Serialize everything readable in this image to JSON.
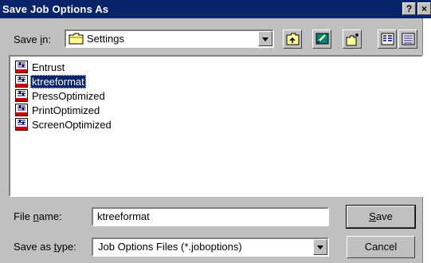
{
  "window": {
    "title": "Save Job Options As",
    "help_glyph": "?",
    "close_glyph": "×"
  },
  "save_in": {
    "label_pre": "Save ",
    "label_hot": "i",
    "label_post": "n:",
    "value": "Settings"
  },
  "toolbar": [
    "up-one-level",
    "desktop",
    "create-new-folder",
    "list-view",
    "details-view"
  ],
  "files": [
    {
      "name": "Entrust",
      "selected": false
    },
    {
      "name": "ktreeformat",
      "selected": true
    },
    {
      "name": "PressOptimized",
      "selected": false
    },
    {
      "name": "PrintOptimized",
      "selected": false
    },
    {
      "name": "ScreenOptimized",
      "selected": false
    }
  ],
  "file_name": {
    "label_pre": "File ",
    "label_hot": "n",
    "label_post": "ame:",
    "value": "ktreeformat"
  },
  "save_as_type": {
    "label_pre": "Save as ",
    "label_hot": "t",
    "label_post": "ype:",
    "value": "Job Options Files (*.joboptions)"
  },
  "buttons": {
    "save_hot": "S",
    "save_rest": "ave",
    "cancel": "Cancel"
  },
  "colors": {
    "titlebar": "#0a246a",
    "face": "#c0c0c0",
    "selection": "#0a246a",
    "folder": "#ffff99"
  }
}
